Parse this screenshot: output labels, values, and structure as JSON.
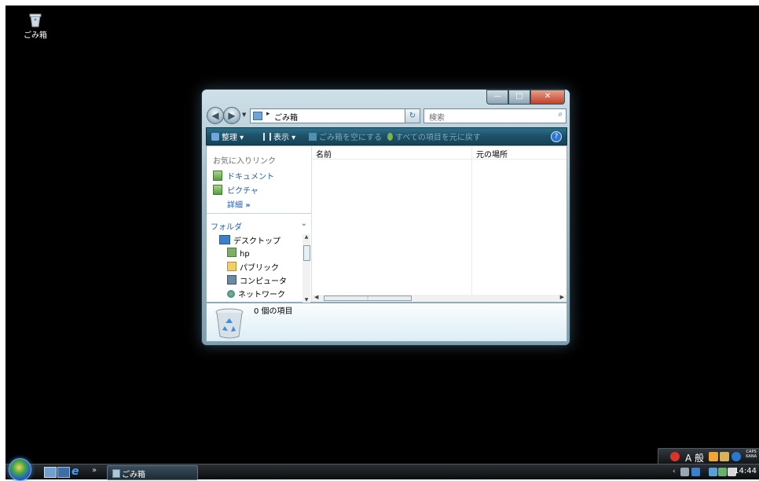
{
  "desktop": {
    "recycle_icon_label": "ごみ箱"
  },
  "window": {
    "address": {
      "breadcrumb": "ごみ箱",
      "separator": "▸"
    },
    "search": {
      "placeholder": "検索"
    },
    "toolbar": {
      "organize": "整理",
      "views": "表示",
      "empty_bin": "ごみ箱を空にする",
      "restore_all": "すべての項目を元に戻す"
    },
    "nav": {
      "favorites_header": "お気に入りリンク",
      "favorites": [
        "ドキュメント",
        "ピクチャ"
      ],
      "more": "詳細"
    },
    "folders": {
      "header": "フォルダ",
      "items": [
        "デスクトップ",
        "hp",
        "パブリック",
        "コンピュータ",
        "ネットワーク"
      ]
    },
    "columns": [
      "名前",
      "元の場所"
    ],
    "status": "0 個の項目"
  },
  "taskbar": {
    "task_button": "ごみ箱",
    "clock": "14:44",
    "ime_mode": "A 般",
    "caps": "CAPS",
    "kana": "KANA"
  }
}
